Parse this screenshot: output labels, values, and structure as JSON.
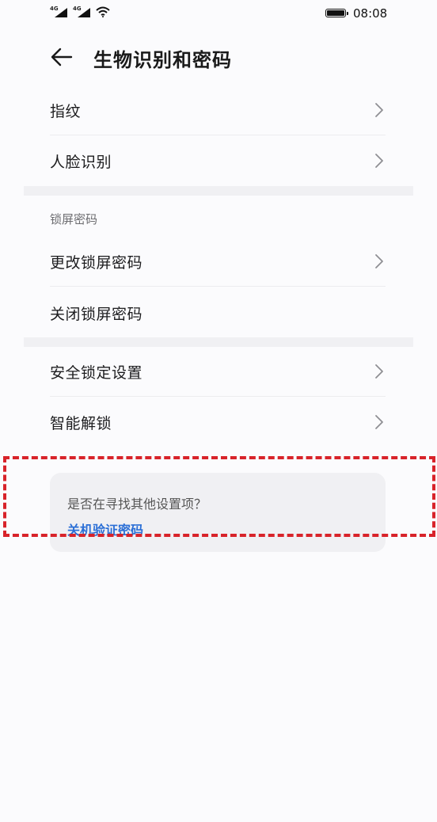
{
  "status_bar": {
    "sim1_tag": "4G",
    "sim2_tag": "4G",
    "time": "08:08",
    "icons": [
      "signal-icon",
      "signal-icon",
      "wifi-icon",
      "battery-icon"
    ]
  },
  "header": {
    "title": "生物识别和密码",
    "back_icon": "arrow-left-icon"
  },
  "group1": {
    "items": [
      {
        "label": "指纹",
        "chevron": true
      },
      {
        "label": "人脸识别",
        "chevron": true
      }
    ]
  },
  "group2": {
    "title": "锁屏密码",
    "items": [
      {
        "label": "更改锁屏密码",
        "chevron": true
      },
      {
        "label": "关闭锁屏密码",
        "chevron": false
      }
    ]
  },
  "group3": {
    "items": [
      {
        "label": "安全锁定设置",
        "chevron": true
      },
      {
        "label": "智能解锁",
        "chevron": true
      }
    ]
  },
  "suggestion": {
    "question": "是否在寻找其他设置项？",
    "link": "关机验证密码"
  },
  "colors": {
    "highlight_border": "#d8232a",
    "link": "#2b6fd6",
    "background": "#fbfbfd",
    "card": "#f0f0f3"
  }
}
